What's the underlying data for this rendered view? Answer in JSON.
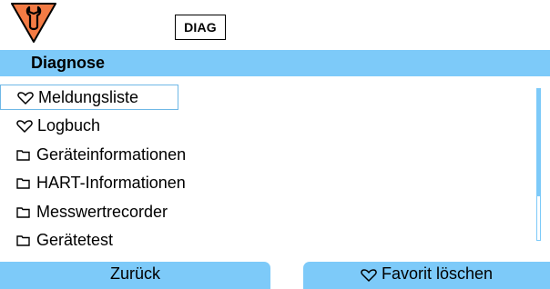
{
  "header": {
    "status_icon": "maintenance-warning-icon",
    "badge_label": "DIAG"
  },
  "title": "Diagnose",
  "menu": {
    "items": [
      {
        "label": "Meldungsliste",
        "icon": "heart-icon",
        "selected": true
      },
      {
        "label": "Logbuch",
        "icon": "heart-icon",
        "selected": false
      },
      {
        "label": "Geräteinformationen",
        "icon": "folder-icon",
        "selected": false
      },
      {
        "label": "HART-Informationen",
        "icon": "folder-icon",
        "selected": false
      },
      {
        "label": "Messwertrecorder",
        "icon": "folder-icon",
        "selected": false
      },
      {
        "label": "Gerätetest",
        "icon": "folder-icon",
        "selected": false
      }
    ]
  },
  "footer": {
    "back_label": "Zurück",
    "favorite_label": "Favorit löschen",
    "favorite_icon": "heart-icon"
  },
  "colors": {
    "accent": "#7dcaf9",
    "warning": "#f47b44"
  }
}
